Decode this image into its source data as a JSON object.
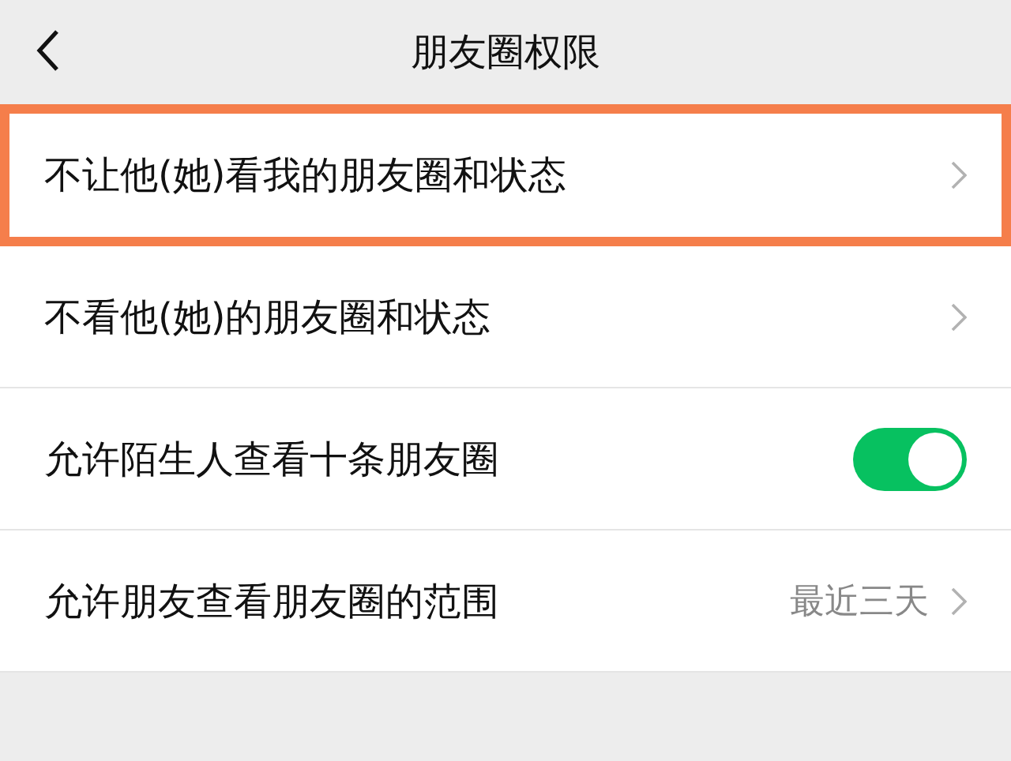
{
  "header": {
    "title": "朋友圈权限"
  },
  "rows": [
    {
      "kind": "link",
      "label": "不让他(她)看我的朋友圈和状态",
      "highlighted": true
    },
    {
      "kind": "link",
      "label": "不看他(她)的朋友圈和状态",
      "highlighted": false
    },
    {
      "kind": "toggle",
      "label": "允许陌生人查看十条朋友圈",
      "highlighted": false,
      "on": true
    },
    {
      "kind": "value",
      "label": "允许朋友查看朋友圈的范围",
      "highlighted": false,
      "value": "最近三天"
    }
  ]
}
